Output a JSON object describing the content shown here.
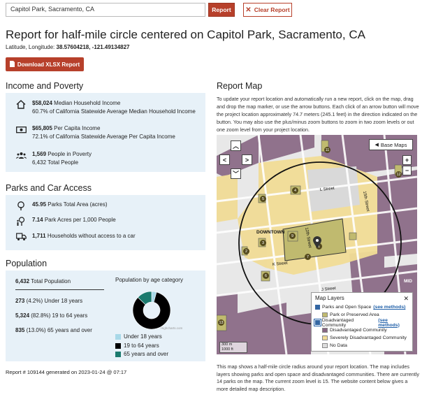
{
  "search": {
    "value": "Capitol Park, Sacramento, CA"
  },
  "buttons": {
    "report": "Report",
    "clear": "Clear Report",
    "download": "Download XLSX Report"
  },
  "header": {
    "title": "Report for half-mile circle centered on Capitol Park, Sacramento, CA",
    "latlon_label": "Latitude, Longitude:",
    "latlon_value": "38.57604218, -121.49134827"
  },
  "income": {
    "heading": "Income and Poverty",
    "items": [
      {
        "icon": "home-icon",
        "value": "$58,024",
        "label": "Median Household Income",
        "sub": "60.7% of California Statewide Average Median Household Income"
      },
      {
        "icon": "money-icon",
        "value": "$65,805",
        "label": "Per Capita Income",
        "sub": "72.1% of California Statewide Average Per Capita Income"
      },
      {
        "icon": "people-icon",
        "value": "1,569",
        "label": "People in Poverty",
        "sub": "6,432 Total People"
      }
    ]
  },
  "parks": {
    "heading": "Parks and Car Access",
    "items": [
      {
        "icon": "tree-icon",
        "value": "45.95",
        "label": "Parks Total Area (acres)"
      },
      {
        "icon": "park-person-icon",
        "value": "7.14",
        "label": "Park Acres per 1,000 People"
      },
      {
        "icon": "car-icon",
        "value": "1,711",
        "label": "Households without access to a car"
      }
    ]
  },
  "population": {
    "heading": "Population",
    "total_value": "6,432",
    "total_label": "Total Population",
    "rows": [
      {
        "value": "273",
        "pct": "(4.2%)",
        "label": "Under 18 years"
      },
      {
        "value": "5,324",
        "pct": "(82.8%)",
        "label": "19 to 64 years"
      },
      {
        "value": "835",
        "pct": "(13.0%)",
        "label": "65 years and over"
      }
    ],
    "chart_credit": "Highcharts.com"
  },
  "chart_data": {
    "type": "pie",
    "title": "Population by age category",
    "categories": [
      "Under 18 years",
      "19 to 64 years",
      "65 years and over"
    ],
    "values": [
      4.2,
      82.8,
      13.0
    ],
    "colors": [
      "#a8d8e8",
      "#000000",
      "#1b7a6e"
    ],
    "legend": "bottom"
  },
  "footer": {
    "text": "Report # 109144 generated on 2023-01-24 @ 07:17"
  },
  "map": {
    "heading": "Report Map",
    "instructions": "To update your report location and automatically run a new report, click on the map, drag and drop the map marker, or use the arrow buttons. Each click of an arrow button will move the project location approximately 74.7 meters (245.1 feet) in the direction indicated on the button. You may also use the plus/minus zoom buttons to zoom in two zoom levels or out one zoom level from your project location.",
    "base_maps_label": "Base Maps",
    "labels": {
      "downtown": "DOWNTOWN",
      "l_street": "L Street",
      "k_street": "K Street",
      "j_street": "J Street",
      "street_12": "12th Street",
      "street_15": "15th Street",
      "midtown": "MID",
      "scale_m": "300 m",
      "scale_ft": "1000 ft"
    },
    "markers": [
      "11",
      "12",
      "4",
      "5",
      "9",
      "1",
      "3",
      "2",
      "6",
      "7",
      "13"
    ],
    "layers": {
      "title": "Map Layers",
      "parks": "Parks and Open Space",
      "disadvantaged": "Disadvantaged Community",
      "see_methods": "(see methods)",
      "park_item": "Park or Preserved Area",
      "dac_item": "Disadvantaged Community",
      "sdac_item": "Severely Disadvantaged Community",
      "nodata": "No Data",
      "colors": {
        "park": "#c0ba6f",
        "dac": "#876683",
        "sdac": "#f1dc96",
        "nodata": "#dddddd"
      }
    },
    "description": "This map shows a half-mile circle radius around your report location. The map includes layers showing parks and open space and disadvantaged communities. There are currently 14 parks on the map. The current zoom level is 15. The website content below gives a more detailed map description."
  }
}
